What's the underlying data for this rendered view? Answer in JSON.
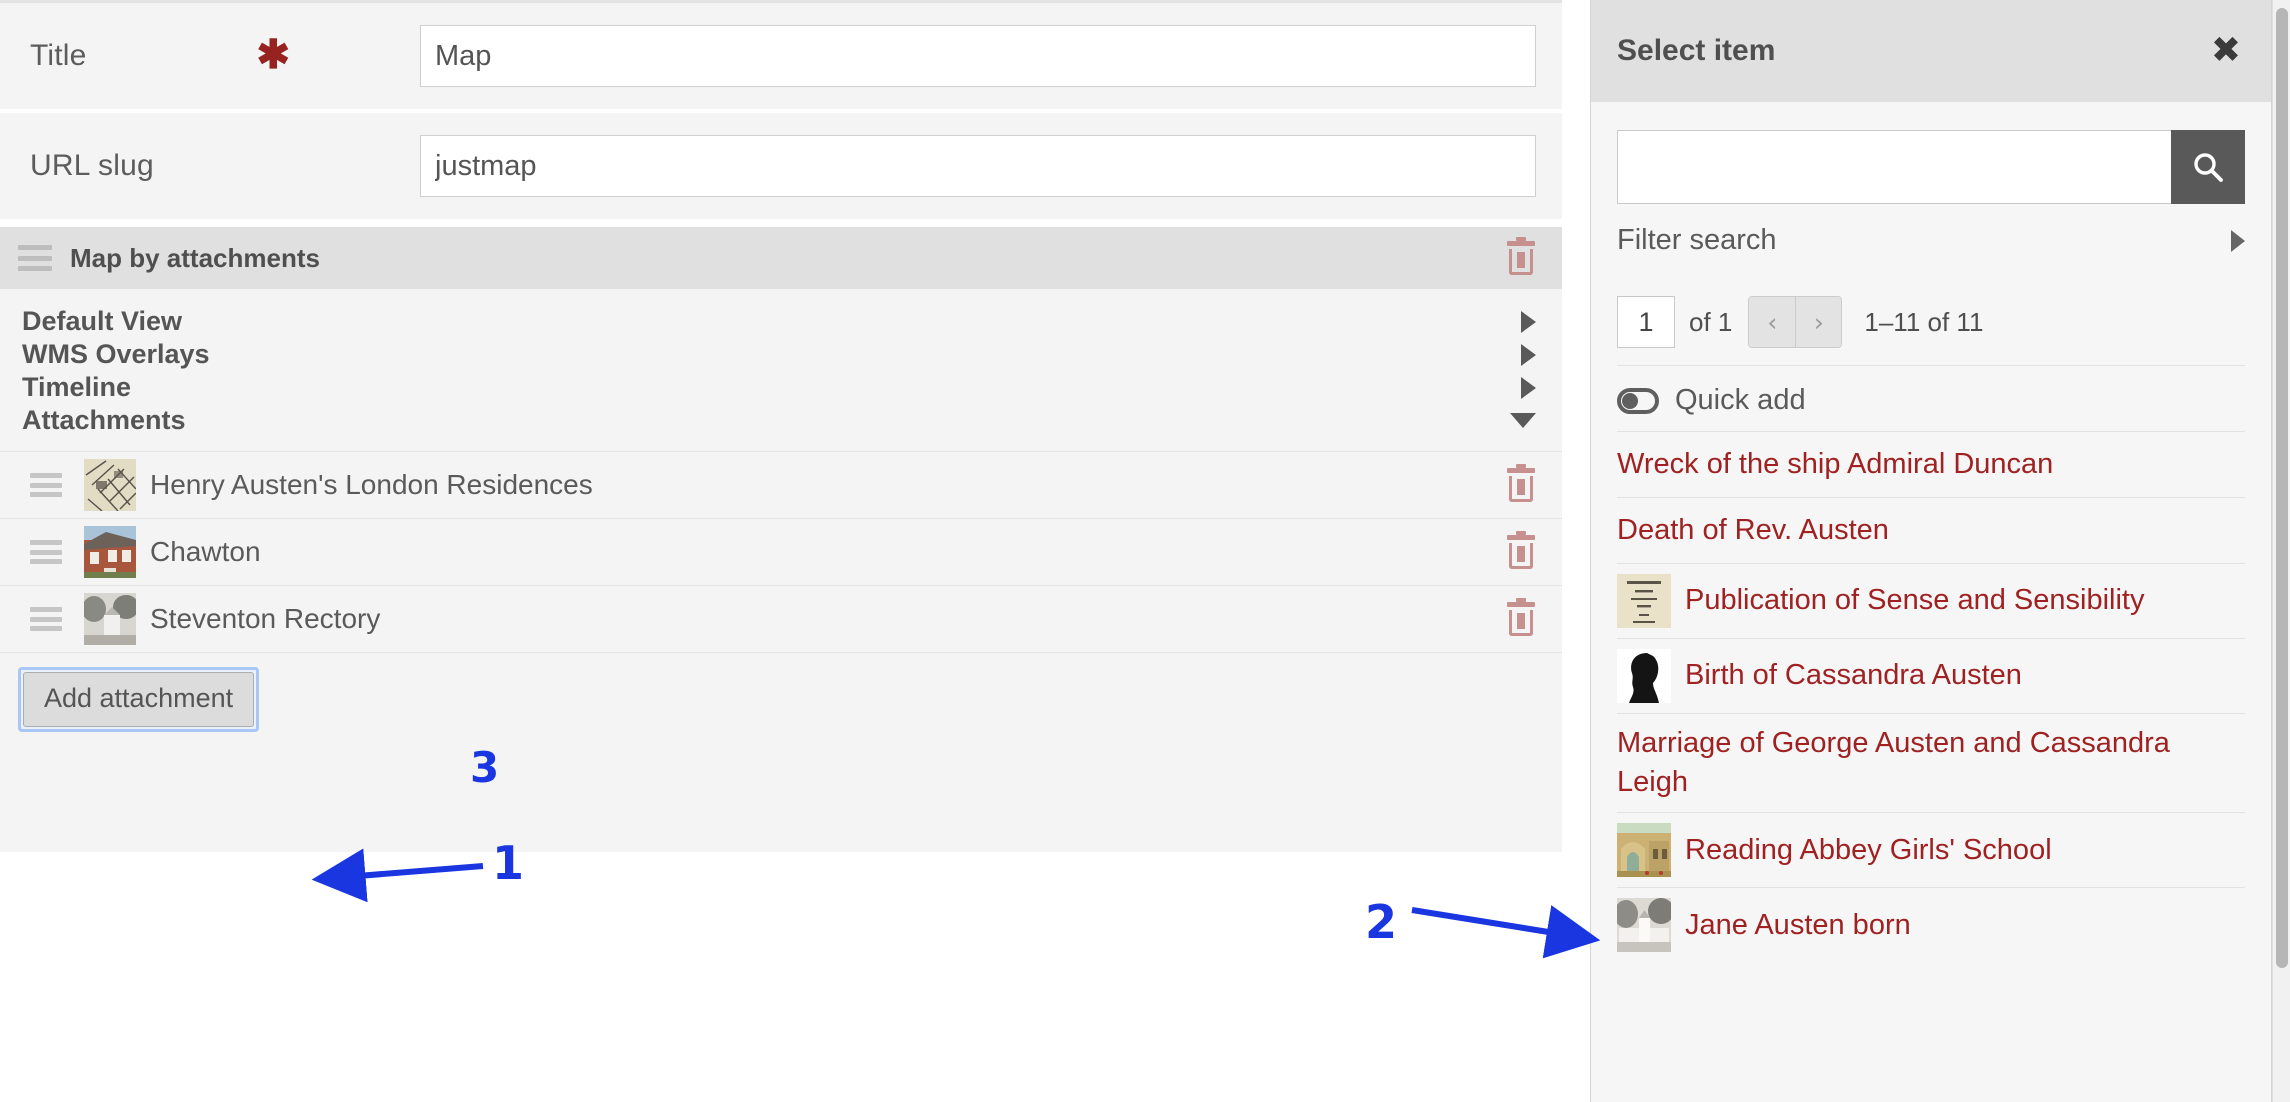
{
  "form": {
    "fields": [
      {
        "label": "Title",
        "required": true,
        "value": "Map",
        "placeholder": ""
      },
      {
        "label": "URL slug",
        "required": false,
        "value": "justmap",
        "placeholder": ""
      }
    ],
    "block": {
      "title": "Map by attachments",
      "delete_icon": "trash-icon",
      "drag_icon": "drag-handle-icon",
      "sections": [
        {
          "label": "Default View",
          "expanded": false
        },
        {
          "label": "WMS Overlays",
          "expanded": false
        },
        {
          "label": "Timeline",
          "expanded": false
        },
        {
          "label": "Attachments",
          "expanded": true
        }
      ],
      "attachments": [
        {
          "name": "Henry Austen's London Residences",
          "thumb": "old-map-thumb"
        },
        {
          "name": "Chawton",
          "thumb": "brick-cottage-thumb"
        },
        {
          "name": "Steventon Rectory",
          "thumb": "rectory-engraving-thumb"
        }
      ],
      "add_button": "Add attachment"
    }
  },
  "panel": {
    "title": "Select item",
    "close_icon": "close-icon",
    "search": {
      "value": "",
      "placeholder": "",
      "button_icon": "search-icon"
    },
    "filter": {
      "label": "Filter search",
      "arrow_icon": "chevron-right-icon"
    },
    "pager": {
      "page": "1",
      "of_label": "of 1",
      "prev_icon": "chevron-left-icon",
      "next_icon": "chevron-right-icon",
      "prev_label": "‹",
      "next_label": "›",
      "range": "1–11 of 11"
    },
    "quick_add": {
      "label": "Quick add",
      "icon": "toggle-switch-icon"
    },
    "results": [
      {
        "label": "Wreck of the ship Admiral Duncan",
        "thumb": null,
        "wrap": false
      },
      {
        "label": "Death of Rev. Austen",
        "thumb": null,
        "wrap": false
      },
      {
        "label": "Publication of Sense and Sensibility",
        "thumb": "title-page-thumb",
        "wrap": false
      },
      {
        "label": "Birth of Cassandra Austen",
        "thumb": "silhouette-thumb",
        "wrap": false
      },
      {
        "label": "Marriage of George Austen and Cassandra Leigh",
        "thumb": null,
        "wrap": true
      },
      {
        "label": "Reading Abbey Girls' School",
        "thumb": "abbey-painting-thumb",
        "wrap": false
      },
      {
        "label": "Jane Austen born",
        "thumb": "house-engraving-thumb",
        "wrap": false
      }
    ]
  },
  "annotations": [
    {
      "number": "1",
      "target": "add-attachment-button"
    },
    {
      "number": "2",
      "target": "reading-abbey-girls-school-result"
    },
    {
      "number": "3",
      "target": "steventon-rectory-attachment"
    }
  ],
  "colors": {
    "annotation_blue": "#1a36e0",
    "link_red": "#9f2121",
    "required_star": "#96231f",
    "trash_pink": "#c6908f"
  }
}
